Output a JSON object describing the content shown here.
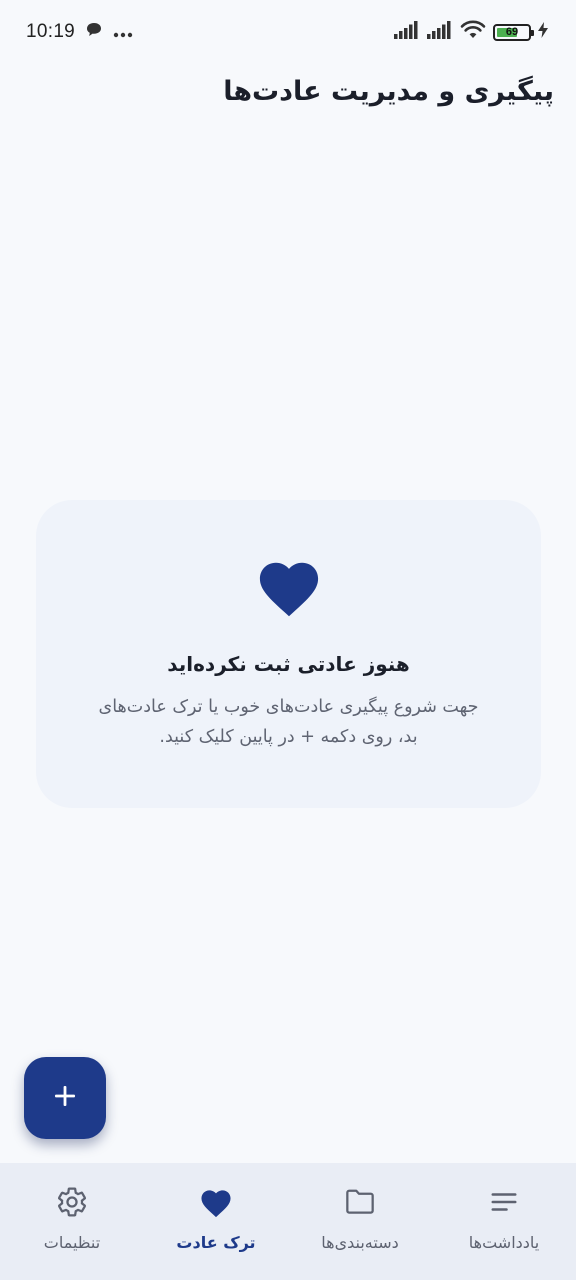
{
  "status_bar": {
    "time": "10:19",
    "battery_level": "69",
    "icons": [
      "chat-bubble-icon",
      "more-dots-icon",
      "signal-icon",
      "signal-icon",
      "wifi-icon",
      "battery-icon",
      "charging-bolt-icon"
    ]
  },
  "header": {
    "title": "پیگیری و مدیریت عادت‌ها"
  },
  "empty_state": {
    "icon": "heart-icon",
    "title": "هنوز عادتی ثبت نکرده‌اید",
    "description": "جهت شروع پیگیری عادت‌های خوب یا ترک عادت‌های بد، روی دکمه + در پایین کلیک کنید."
  },
  "fab": {
    "icon": "plus-icon"
  },
  "bottom_nav": {
    "items": [
      {
        "label": "تنظیمات",
        "icon": "gear-icon",
        "active": false
      },
      {
        "label": "ترک عادت",
        "icon": "heart-icon",
        "active": true
      },
      {
        "label": "دسته‌بندی‌ها",
        "icon": "folder-icon",
        "active": false
      },
      {
        "label": "یادداشت‌ها",
        "icon": "notes-icon",
        "active": false
      }
    ]
  },
  "colors": {
    "primary": "#1e3a8a",
    "background": "#f7f9fc",
    "card": "#eff3fa",
    "nav_background": "#e9edf5",
    "muted_text": "#5d6270"
  }
}
